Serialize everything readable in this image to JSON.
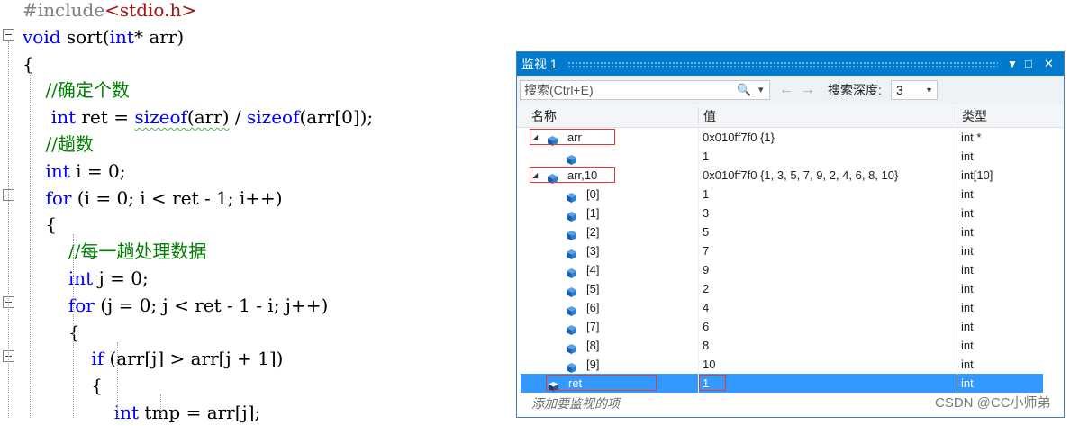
{
  "editor": {
    "lines": [
      {
        "html": "<span class='pp'>#include</span><span class='str'>&lt;stdio.h&gt;</span>"
      },
      {
        "html": "<span class='kw'>void</span> <span class='fn'>sort</span>(<span class='kw'>int</span>* <span class='id'>arr</span>)"
      },
      {
        "html": "{"
      },
      {
        "html": "    <span class='cm'>//确定个数</span>"
      },
      {
        "html": "     <span class='kw'>int</span> <span class='id'>ret</span> = <span class='kw sq'>sizeof</span><span class='sq'>(arr)</span> / <span class='kw'>sizeof</span>(arr[0]);"
      },
      {
        "html": "    <span class='cm'>//趟数</span>"
      },
      {
        "html": "    <span class='kw'>int</span> <span class='id'>i</span> = 0;"
      },
      {
        "html": "    <span class='kw'>for</span> (i = 0; i &lt; ret - 1; i++)"
      },
      {
        "html": "    {"
      },
      {
        "html": "        <span class='cm'>//每一趟处理数据</span>"
      },
      {
        "html": "        <span class='kw'>int</span> <span class='id'>j</span> = 0;"
      },
      {
        "html": "        <span class='kw'>for</span> (j = 0; j &lt; ret - 1 - i; j++)"
      },
      {
        "html": "        {"
      },
      {
        "html": "            <span class='kw'>if</span> (arr[j] &gt; arr[j + 1])"
      },
      {
        "html": "            {"
      },
      {
        "html": "                <span class='kw'>int</span> <span class='id'>tmp</span> = arr[j];"
      }
    ]
  },
  "watch": {
    "title": "监视 1",
    "title_buttons": [
      "▼",
      "□",
      "✕"
    ],
    "search_placeholder": "搜索(Ctrl+E)",
    "search_icon": "🔍",
    "search_dropdown": "▾",
    "back_arrow": "←",
    "forward_arrow": "→",
    "depth_label": "搜索深度:",
    "depth_value": "3",
    "depth_arrow": "▼",
    "columns": {
      "name": "名称",
      "value": "值",
      "type": "类型"
    },
    "rows": [
      {
        "name": "arr",
        "value": "0x010ff7f0 {1}",
        "type": "int *",
        "expanded": true,
        "indent": 0,
        "boxed": true
      },
      {
        "name": "",
        "value": "1",
        "type": "int",
        "indent": 1
      },
      {
        "name": "arr,10",
        "value": "0x010ff7f0 {1, 3, 5, 7, 9, 2, 4, 6, 8, 10}",
        "type": "int[10]",
        "expanded": true,
        "indent": 0,
        "boxed": true
      },
      {
        "name": "[0]",
        "value": "1",
        "type": "int",
        "indent": 1
      },
      {
        "name": "[1]",
        "value": "3",
        "type": "int",
        "indent": 1
      },
      {
        "name": "[2]",
        "value": "5",
        "type": "int",
        "indent": 1
      },
      {
        "name": "[3]",
        "value": "7",
        "type": "int",
        "indent": 1
      },
      {
        "name": "[4]",
        "value": "9",
        "type": "int",
        "indent": 1
      },
      {
        "name": "[5]",
        "value": "2",
        "type": "int",
        "indent": 1
      },
      {
        "name": "[6]",
        "value": "4",
        "type": "int",
        "indent": 1
      },
      {
        "name": "[7]",
        "value": "6",
        "type": "int",
        "indent": 1
      },
      {
        "name": "[8]",
        "value": "8",
        "type": "int",
        "indent": 1
      },
      {
        "name": "[9]",
        "value": "10",
        "type": "int",
        "indent": 1
      },
      {
        "name": "ret",
        "value": "1",
        "type": "int",
        "indent": 0,
        "selected": true,
        "boxed": true
      }
    ],
    "add_watch_label": "添加要监视的项"
  },
  "watermark": "CSDN @CC小师弟",
  "colors": {
    "title_bar": "#007acc",
    "selection": "#3399ff",
    "highlight_box": "#e53935",
    "keyword": "#0000ff",
    "comment": "#008000"
  }
}
